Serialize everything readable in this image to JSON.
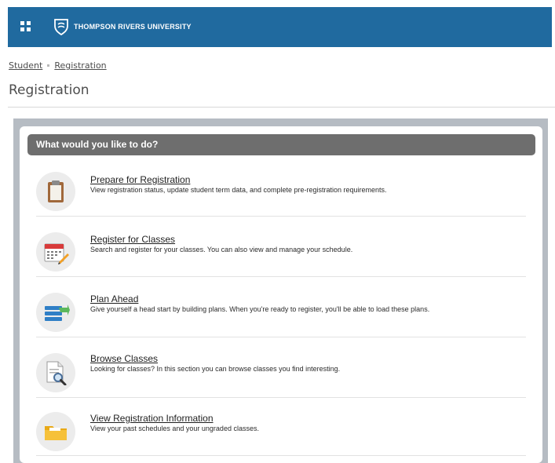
{
  "header": {
    "apps_icon": "grid-icon",
    "logo_icon": "university-shield-icon",
    "university_name": "THOMPSON RIVERS UNIVERSITY",
    "brand_color": "#206a9f"
  },
  "breadcrumb": {
    "items": [
      "Student",
      "Registration"
    ]
  },
  "page": {
    "title": "Registration"
  },
  "panel": {
    "header": "What would you like to do?",
    "items": [
      {
        "icon": "clipboard-icon",
        "title": "Prepare for Registration",
        "description": "View registration status, update student term data, and complete pre-registration requirements."
      },
      {
        "icon": "calendar-pencil-icon",
        "title": "Register for Classes",
        "description": "Search and register for your classes. You can also view and manage your schedule."
      },
      {
        "icon": "list-arrow-icon",
        "title": "Plan Ahead",
        "description": "Give yourself a head start by building plans. When you're ready to register, you'll be able to load these plans."
      },
      {
        "icon": "document-magnifier-icon",
        "title": "Browse Classes",
        "description": "Looking for classes? In this section you can browse classes you find interesting."
      },
      {
        "icon": "folder-icon",
        "title": "View Registration Information",
        "description": "View your past schedules and your ungraded classes."
      }
    ]
  }
}
